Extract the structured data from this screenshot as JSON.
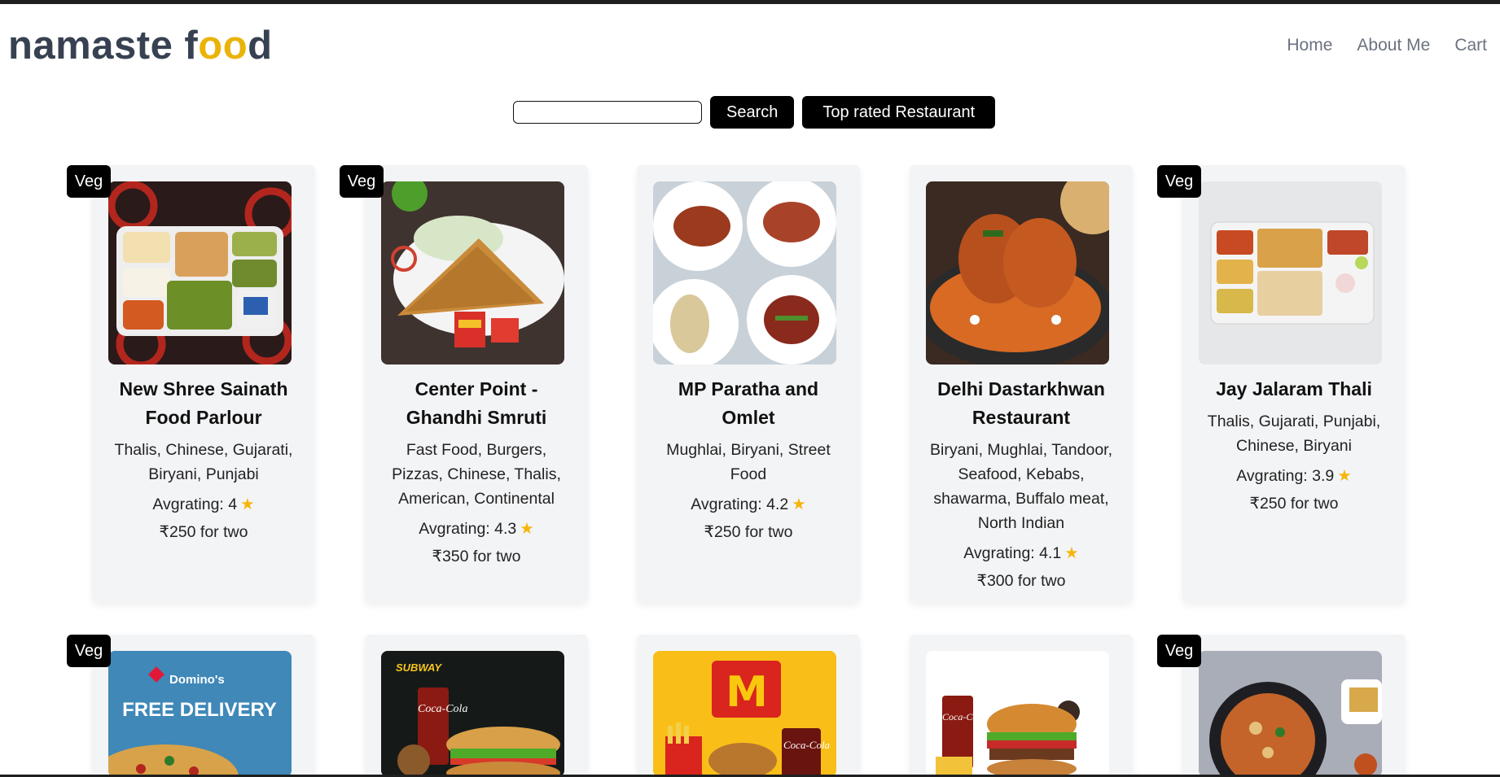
{
  "header": {
    "logo_part1": "namaste f",
    "logo_part2": "oo",
    "logo_part3": "d",
    "nav": [
      "Home",
      "About Me",
      "Cart"
    ]
  },
  "search": {
    "value": "",
    "button_label": "Search",
    "top_rated_label": "Top rated Restaurant"
  },
  "veg_label": "Veg",
  "restaurants": [
    {
      "name": "New Shree Sainath Food Parlour",
      "cuisines": "Thalis, Chinese, Gujarati, Biryani, Punjabi",
      "rating_label": "Avgrating: 4",
      "cost": "₹250 for two",
      "veg": true
    },
    {
      "name": "Center Point - Ghandhi Smruti",
      "cuisines": "Fast Food, Burgers, Pizzas, Chinese, Thalis, American, Continental",
      "rating_label": "Avgrating: 4.3",
      "cost": "₹350 for two",
      "veg": true
    },
    {
      "name": "MP Paratha and Omlet",
      "cuisines": "Mughlai, Biryani, Street Food",
      "rating_label": "Avgrating: 4.2",
      "cost": "₹250 for two",
      "veg": false
    },
    {
      "name": "Delhi Dastarkhwan Restaurant",
      "cuisines": "Biryani, Mughlai, Tandoor, Seafood, Kebabs, shawarma, Buffalo meat, North Indian",
      "rating_label": "Avgrating: 4.1",
      "cost": "₹300 for two",
      "veg": false
    },
    {
      "name": "Jay Jalaram Thali",
      "cuisines": "Thalis, Gujarati, Punjabi, Chinese, Biryani",
      "rating_label": "Avgrating: 3.9",
      "cost": "₹250 for two",
      "veg": true
    }
  ],
  "row2": [
    {
      "veg": true,
      "brand_text": "Domino's",
      "promo": "FREE DELIVERY"
    },
    {
      "veg": false,
      "brand_text": "SUBWAY",
      "drink": "Coca-Cola"
    },
    {
      "veg": false,
      "brand_text": "M",
      "drink": "Coca-Cola"
    },
    {
      "veg": false,
      "drink": "Coca-Cola"
    },
    {
      "veg": true
    }
  ]
}
